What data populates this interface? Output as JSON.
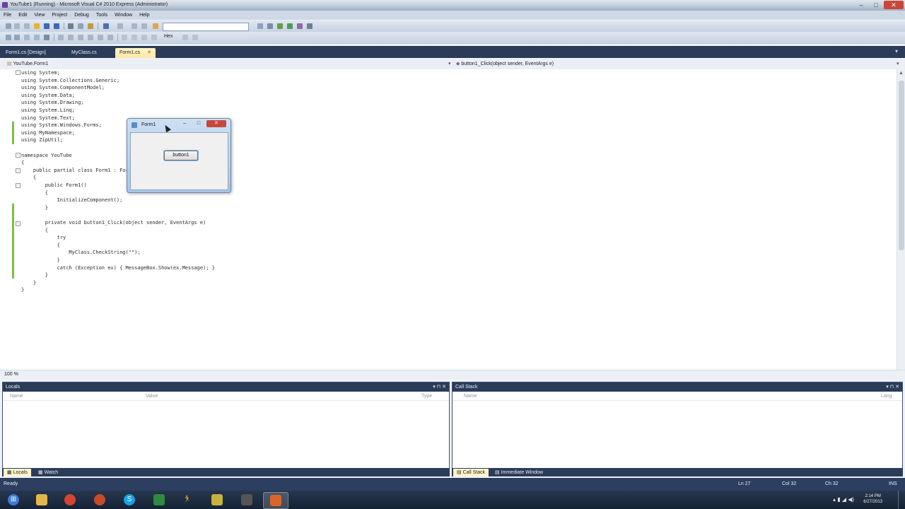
{
  "window": {
    "title": "YouTube1 (Running) - Microsoft Visual C# 2010 Express (Administrator)",
    "controls": [
      "–",
      "□",
      "✕"
    ]
  },
  "menu": [
    "File",
    "Edit",
    "View",
    "Project",
    "Debug",
    "Tools",
    "Window",
    "Help"
  ],
  "toolbar": {
    "hex_label": "Hex"
  },
  "doc_tabs": [
    {
      "label": "Form1.cs [Design]",
      "active": false
    },
    {
      "label": "MyClass.cs",
      "active": false
    },
    {
      "label": "Form1.cs",
      "active": true
    }
  ],
  "nav": {
    "type": "YouTube.Form1",
    "member": "button1_Click(object sender, EventArgs e)"
  },
  "code_lines": [
    "using System;",
    "using System.Collections.Generic;",
    "using System.ComponentModel;",
    "using System.Data;",
    "using System.Drawing;",
    "using System.Linq;",
    "using System.Text;",
    "using System.Windows.Forms;",
    "using MyNamespace;",
    "using ZipUtil;",
    "",
    "namespace YouTube",
    "{",
    "    public partial class Form1 : Form",
    "    {",
    "        public Form1()",
    "        {",
    "            InitializeComponent();",
    "        }",
    "",
    "        private void button1_Click(object sender, EventArgs e)",
    "        {",
    "            try",
    "            {",
    "                MyClass.CheckString(\"\");",
    "            }",
    "            catch (Exception ex) { MessageBox.Show(ex.Message); }",
    "        }",
    "    }",
    "}"
  ],
  "editor": {
    "zoom": "100 %"
  },
  "running_form": {
    "title": "Form1",
    "button_label": "button1"
  },
  "locals_panel": {
    "title": "Locals",
    "columns": [
      "Name",
      "Value",
      "Type"
    ],
    "tabs": [
      {
        "label": "Locals",
        "active": true
      },
      {
        "label": "Watch",
        "active": false
      }
    ]
  },
  "callstack_panel": {
    "title": "Call Stack",
    "columns": [
      "Name",
      "Lang"
    ],
    "tabs": [
      {
        "label": "Call Stack",
        "active": true
      },
      {
        "label": "Immediate Window",
        "active": false
      }
    ]
  },
  "status": {
    "text": "Ready",
    "line": "Ln 27",
    "col": "Col 32",
    "ch": "Ch 32",
    "mode": "INS"
  },
  "taskbar": {
    "apps": [
      {
        "name": "start-orb",
        "color": "#3a7bd5",
        "active": false
      },
      {
        "name": "explorer",
        "color": "#e2b64a",
        "active": false
      },
      {
        "name": "chrome",
        "color": "#d64531",
        "active": false
      },
      {
        "name": "media",
        "color": "#c94a2a",
        "active": false
      },
      {
        "name": "skype",
        "color": "#1aa1e1",
        "active": false
      },
      {
        "name": "excel",
        "color": "#2e8b3e",
        "active": false
      },
      {
        "name": "runner",
        "color": "#e6a700",
        "active": false
      },
      {
        "name": "folder",
        "color": "#c7b23c",
        "active": false
      },
      {
        "name": "tool",
        "color": "#555555",
        "active": false
      },
      {
        "name": "visual-studio",
        "color": "#d9652b",
        "active": true
      }
    ],
    "time": "2:14 PM",
    "date": "6/27/2013"
  }
}
